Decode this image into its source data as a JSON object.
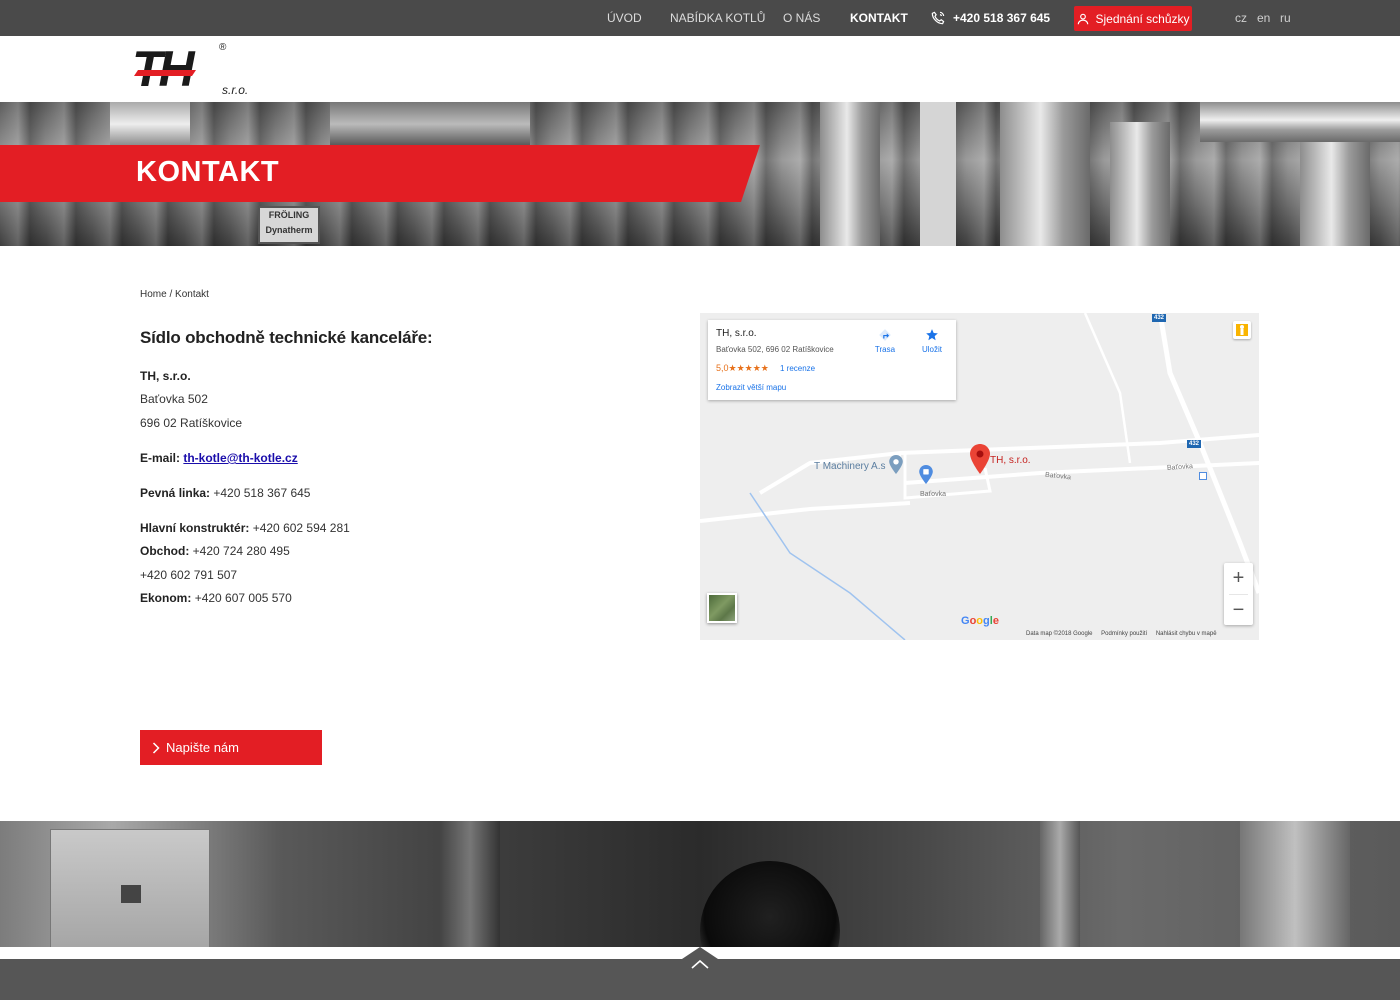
{
  "nav": {
    "items": [
      {
        "label": "ÚVOD",
        "active": false
      },
      {
        "label": "NABÍDKA KOTLŮ",
        "active": false
      },
      {
        "label": "O NÁS",
        "active": false
      },
      {
        "label": "KONTAKT",
        "active": true
      }
    ],
    "phone": "+420 518 367 645",
    "cta": "Sjednání schůzky",
    "languages": [
      "cz",
      "en",
      "ru"
    ]
  },
  "logo": {
    "mark": "TH",
    "suffix": "s.r.o.",
    "registered": "®"
  },
  "hero": {
    "title": "KONTAKT",
    "sign_line1": "FRÖLING",
    "sign_line2": "Dynatherm"
  },
  "breadcrumb": {
    "home": "Home",
    "separator": " / ",
    "current": "Kontakt"
  },
  "contact": {
    "heading": "Sídlo obchodně technické kanceláře:",
    "company": "TH, s.r.o.",
    "street": "Baťovka 502",
    "city": "696 02 Ratíškovice",
    "email_label": "E-mail:",
    "email": "th-kotle@th-kotle.cz",
    "landline_label": "Pevná linka:",
    "landline": "+420 518 367 645",
    "designer_label": "Hlavní konstruktér:",
    "designer": "+420 602 594 281",
    "sales_label": "Obchod:",
    "sales": "+420 724 280 495",
    "sales2": "+420 602 791 507",
    "economist_label": "Ekonom:",
    "economist": "+420 607 005 570"
  },
  "write_button": "Napište nám",
  "map": {
    "card_name": "TH, s.r.o.",
    "card_address": "Baťovka 502, 696 02 Ratíškovice",
    "rating": "5,0",
    "stars": "★★★★★",
    "reviews": "1 recenze",
    "bigger_map": "Zobrazit větší mapu",
    "route": "Trasa",
    "save": "Uložit",
    "pin_main": "TH, s.r.o.",
    "pin_other": "T Machinery A.s",
    "road_1": "Baťovka",
    "road_2": "Baťovka",
    "road_3": "Baťovka",
    "shield_1": "432",
    "shield_2": "432",
    "zoom_in": "+",
    "zoom_out": "−",
    "google": "Google",
    "footer_data": "Data map ©2018 Google",
    "footer_terms": "Podmínky použití",
    "footer_report": "Nahlásit chybu v mapě"
  },
  "colors": {
    "accent": "#e31e24",
    "topbar": "#4a4a4a",
    "footer": "#565656",
    "link": "#1a0dab"
  },
  "icons": [
    "phone-icon",
    "user-icon",
    "chevron-right-icon",
    "chevron-up-icon",
    "directions-icon",
    "star-icon",
    "pegman-icon",
    "map-pin-icon"
  ]
}
